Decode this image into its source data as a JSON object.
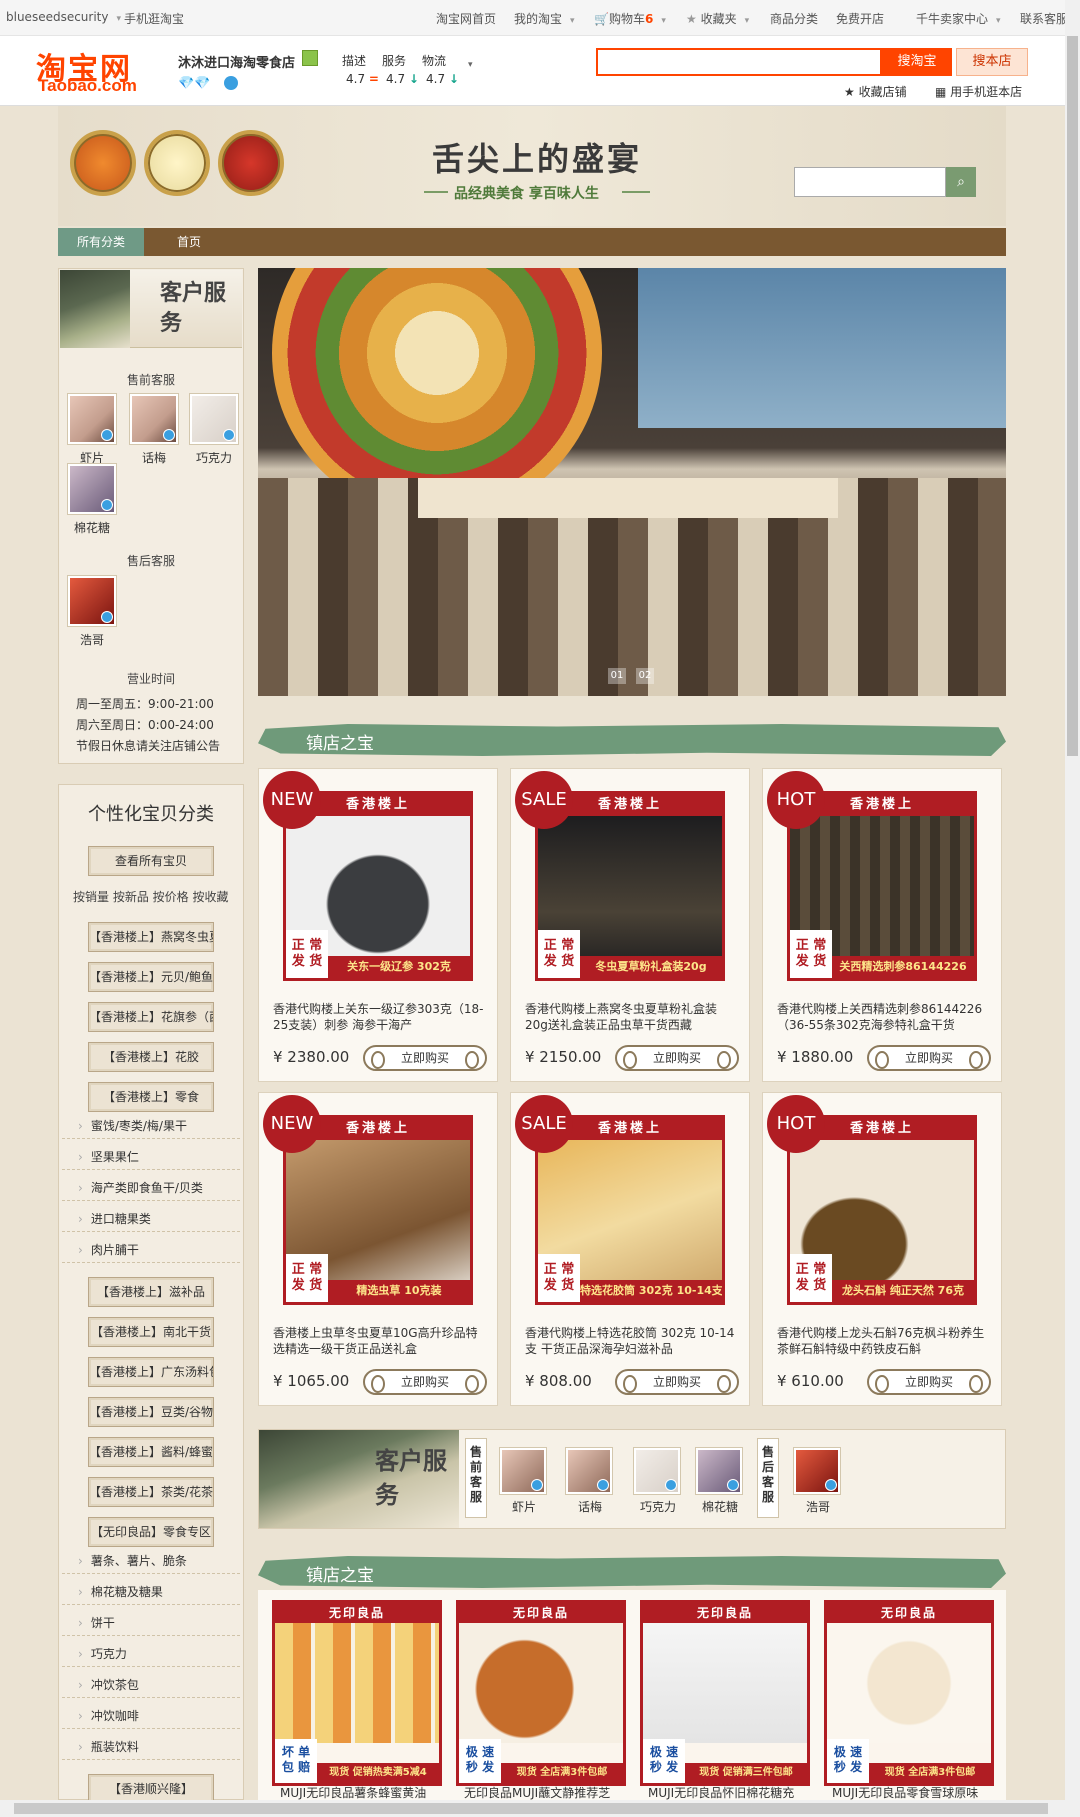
{
  "topbar": {
    "account": "blueseedsecurity",
    "mobile": "手机逛淘宝",
    "home": "淘宝网首页",
    "my_taobao": "我的淘宝",
    "cart": "购物车",
    "cart_count": "6",
    "favorites": "收藏夹",
    "categories": "商品分类",
    "open_shop": "免费开店",
    "seller_center": "千牛卖家中心",
    "contact": "联系客服"
  },
  "header": {
    "logo_cn": "淘宝网",
    "logo_en": "Taobao.com",
    "shop_name": "沐沐进口海淘零食店",
    "scores": [
      {
        "label": "描述",
        "value": "4.7"
      },
      {
        "label": "服务",
        "value": "4.7"
      },
      {
        "label": "物流",
        "value": "4.7"
      }
    ],
    "search_placeholder": "",
    "search_button": "搜淘宝",
    "shop_search_button": "搜本店",
    "favorite_shop": "收藏店铺",
    "mobile_shop": "用手机逛本店"
  },
  "banner": {
    "title": "舌尖上的盛宴",
    "subtitle": "品经典美食 享百味人生",
    "search_placeholder": ""
  },
  "nav": {
    "tabs": [
      "所有分类",
      "首页"
    ]
  },
  "customer_service": {
    "heading": "客户服务",
    "presale_title": "售前客服",
    "presale": [
      "虾片",
      "话梅",
      "巧克力",
      "棉花糖"
    ],
    "aftersale_title": "售后客服",
    "aftersale": [
      "浩哥"
    ],
    "hours_title": "营业时间",
    "hours": [
      "周一至周五：9:00-21:00",
      "周六至周日：0:00-24:00",
      "节假日休息请关注店铺公告"
    ]
  },
  "sidebar_categories": {
    "title": "个性化宝贝分类",
    "view_all": "查看所有宝贝",
    "sorts": "按销量 按新品 按价格 按收藏",
    "items": [
      {
        "type": "button",
        "label": "【香港楼上】燕窝冬虫夏"
      },
      {
        "type": "button",
        "label": "【香港楼上】元贝/鲍鱼"
      },
      {
        "type": "button",
        "label": "【香港楼上】花旗参（西"
      },
      {
        "type": "button",
        "label": "【香港楼上】花胶"
      },
      {
        "type": "button",
        "label": "【香港楼上】零食"
      },
      {
        "type": "link",
        "label": "蜜饯/枣类/梅/果干"
      },
      {
        "type": "link",
        "label": "坚果果仁"
      },
      {
        "type": "link",
        "label": "海产类即食鱼干/贝类"
      },
      {
        "type": "link",
        "label": "进口糖果类"
      },
      {
        "type": "link",
        "label": "肉片脯干"
      },
      {
        "type": "button",
        "label": "【香港楼上】滋补品"
      },
      {
        "type": "button",
        "label": "【香港楼上】南北干货"
      },
      {
        "type": "button",
        "label": "【香港楼上】广东汤料包"
      },
      {
        "type": "button",
        "label": "【香港楼上】豆类/谷物"
      },
      {
        "type": "button",
        "label": "【香港楼上】酱料/蜂蜜"
      },
      {
        "type": "button",
        "label": "【香港楼上】茶类/花茶"
      },
      {
        "type": "button",
        "label": "【无印良品】零食专区"
      },
      {
        "type": "link",
        "label": "薯条、薯片、脆条"
      },
      {
        "type": "link",
        "label": "棉花糖及糖果"
      },
      {
        "type": "link",
        "label": "饼干"
      },
      {
        "type": "link",
        "label": "巧克力"
      },
      {
        "type": "link",
        "label": "冲饮茶包"
      },
      {
        "type": "link",
        "label": "冲饮咖啡"
      },
      {
        "type": "link",
        "label": "瓶装饮料"
      },
      {
        "type": "button",
        "label": "【香港顺兴隆】"
      }
    ]
  },
  "slideshow": {
    "dots": [
      "01",
      "02"
    ]
  },
  "section_title": "镇店之宝",
  "products": [
    {
      "badge": "NEW",
      "brand": "香港楼上",
      "tag": "关东一级辽参 302克",
      "ship": "正 常 发 货",
      "title": "香港代购楼上关东一级辽参303克（18-25支装）刺参 海参干海产",
      "price": "¥ 2380.00",
      "buy": "立即购买"
    },
    {
      "badge": "SALE",
      "brand": "香港楼上",
      "tag": "冬虫夏草粉礼盒装20g",
      "ship": "正 常 发 货",
      "title": "香港代购楼上燕窝冬虫夏草粉礼盒装20g送礼盒装正品虫草干货西藏",
      "price": "¥ 2150.00",
      "buy": "立即购买"
    },
    {
      "badge": "HOT",
      "brand": "香港楼上",
      "tag": "关西精选刺参86144226",
      "ship": "正 常 发 货",
      "title": "香港代购楼上关西精选刺参86144226（36-55条302克海参特礼盒干货",
      "price": "¥ 1880.00",
      "buy": "立即购买"
    },
    {
      "badge": "NEW",
      "brand": "香港楼上",
      "tag": "精选虫草 10克装",
      "ship": "正 常 发 货",
      "title": "香港楼上虫草冬虫夏草10G高升珍品特选精选一级干货正品送礼盒",
      "price": "¥ 1065.00",
      "buy": "立即购买"
    },
    {
      "badge": "SALE",
      "brand": "香港楼上",
      "tag": "特选花胶筒 302克 10-14支",
      "ship": "正 常 发 货",
      "title": "香港代购楼上特选花胶筒 302克 10-14支 干货正品深海孕妇滋补品",
      "price": "¥ 808.00",
      "buy": "立即购买"
    },
    {
      "badge": "HOT",
      "brand": "香港楼上",
      "tag": "龙头石斛 纯正天然 76克",
      "ship": "正 常 发 货",
      "title": "香港代购楼上龙头石斛76克枫斗粉养生茶鲜石斛特级中药铁皮石斛",
      "price": "¥ 610.00",
      "buy": "立即购买"
    }
  ],
  "cs_bar": {
    "heading": "客户服务",
    "presale_label": "售前客服",
    "aftersale_label": "售后客服",
    "presale": [
      "虾片",
      "话梅",
      "巧克力",
      "棉花糖"
    ],
    "aftersale": [
      "浩哥"
    ]
  },
  "section_title_2": "镇店之宝",
  "muji_products": [
    {
      "brand": "无印良品",
      "fa": "坏 单 包 赔",
      "bar": "现货 促销热卖满5减4",
      "title": "MUJI无印良品薯条蜂蜜黄油"
    },
    {
      "brand": "无印良品",
      "fa": "极 速 秒 发",
      "bar": "现货 全店满3件包邮",
      "title": "无印良品MUJI蘸文静推荐芝"
    },
    {
      "brand": "无印良品",
      "fa": "极 速 秒 发",
      "bar": "现货 促销满三件包邮",
      "title": "MUJI无印良品怀旧棉花糖充"
    },
    {
      "brand": "无印良品",
      "fa": "极 速 秒 发",
      "bar": "现货 全店满3件包邮",
      "title": "MUJI无印良品零食雪球原味"
    }
  ]
}
